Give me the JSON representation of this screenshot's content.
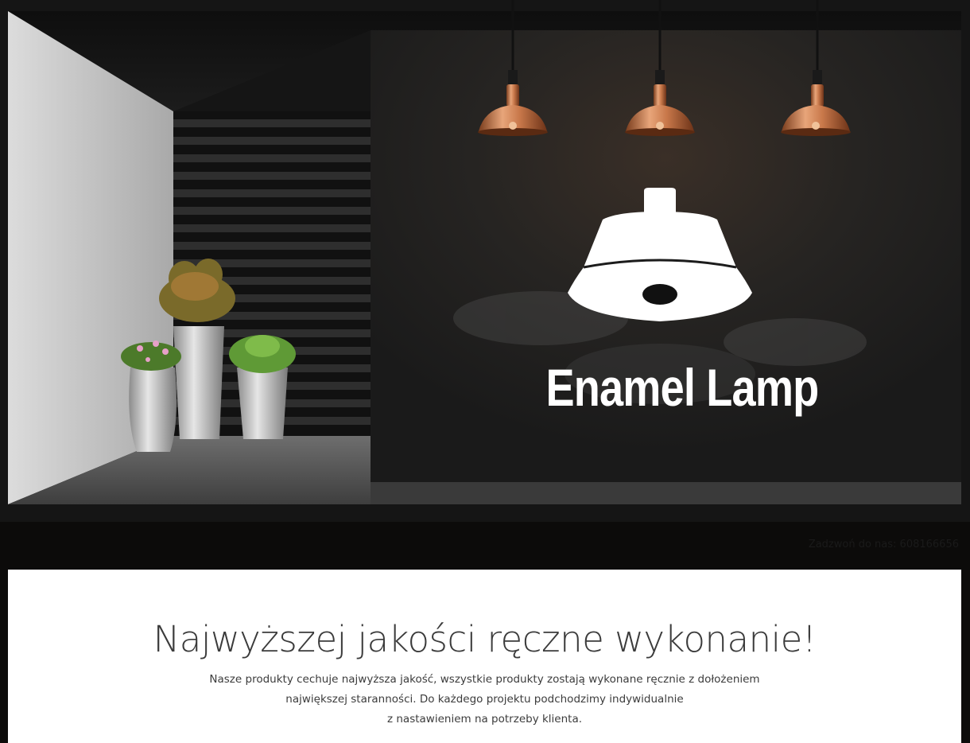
{
  "hero": {
    "brand_name": "Enamel Lamp",
    "logo_icon": "pendant-lamp-icon"
  },
  "contact": {
    "text": "Zadzwoń do nas: 608166656"
  },
  "main": {
    "headline": "Najwyższej jakości ręczne wykonanie!",
    "description_lines": [
      "Nasze produkty cechuje najwyższa jakość, wszystkie produkty zostają wykonane ręcznie z dołożeniem",
      "największej staranności. Do każdego projektu podchodzimy indywidualnie",
      "z nastawieniem na potrzeby klienta."
    ]
  },
  "colors": {
    "page_background": "#0d0c0b",
    "content_background": "#ffffff",
    "headline_color": "#3b3b3b",
    "copper_accent": "#c8784a"
  }
}
